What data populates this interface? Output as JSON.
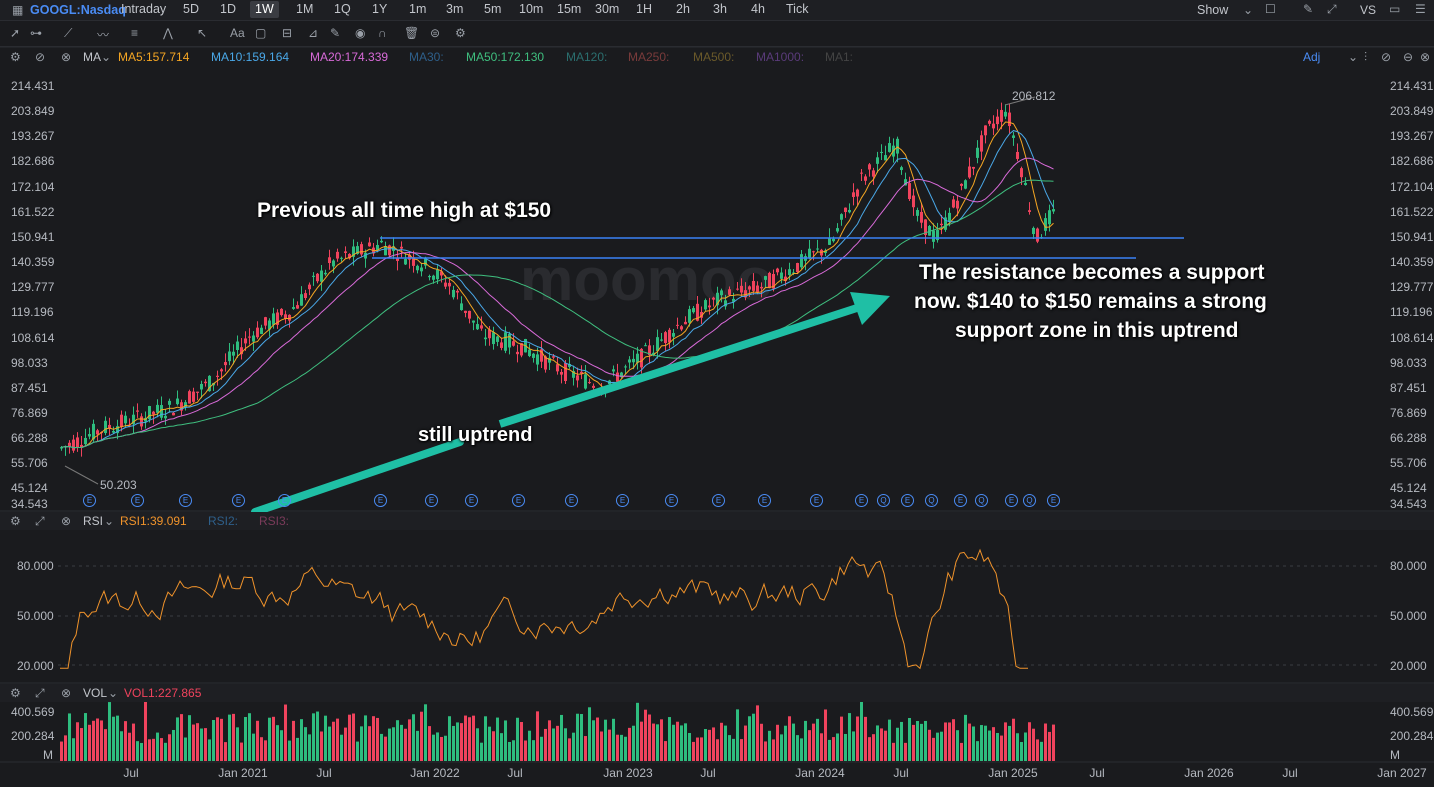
{
  "header": {
    "ticker": "GOOGL:Nasdaq",
    "timeframes": [
      "Intraday",
      "5D",
      "1D",
      "1W",
      "1M",
      "1Q",
      "1Y",
      "1m",
      "3m",
      "5m",
      "10m",
      "15m",
      "30m",
      "1H",
      "2h",
      "3h",
      "4h",
      "Tick"
    ],
    "active_timeframe": "1W",
    "show_label": "Show",
    "vs_label": "VS"
  },
  "ma_bar": {
    "indicator": "MA",
    "items": [
      {
        "label": "MA5:157.714",
        "color": "#f5a623"
      },
      {
        "label": "MA10:159.164",
        "color": "#4aa8e8"
      },
      {
        "label": "MA20:174.339",
        "color": "#d86ad8"
      },
      {
        "label": "MA30:",
        "color": "#2e5f8a"
      },
      {
        "label": "MA50:172.130",
        "color": "#3fbf7f"
      },
      {
        "label": "MA120:",
        "color": "#2b6f6f"
      },
      {
        "label": "MA250:",
        "color": "#7a3b3b"
      },
      {
        "label": "MA500:",
        "color": "#6b5a2a"
      },
      {
        "label": "MA1000:",
        "color": "#5a3b7a"
      },
      {
        "label": "MA1:",
        "color": "#444"
      }
    ],
    "adj_label": "Adj"
  },
  "price_axis": [
    "214.431",
    "203.849",
    "193.267",
    "182.686",
    "172.104",
    "161.522",
    "150.941",
    "140.359",
    "129.777",
    "119.196",
    "108.614",
    "98.033",
    "87.451",
    "76.869",
    "66.288",
    "55.706",
    "45.124",
    "34.543"
  ],
  "price_markers": {
    "high": "206.812",
    "low": "50.203"
  },
  "rsi_bar": {
    "indicator": "RSI",
    "rsi1": "RSI1:39.091",
    "rsi2": "RSI2:",
    "rsi3": "RSI3:"
  },
  "rsi_axis": [
    "80.000",
    "50.000",
    "20.000"
  ],
  "vol_bar": {
    "indicator": "VOL",
    "vol1": "VOL1:227.865"
  },
  "vol_axis": [
    "400.569",
    "200.284",
    "M"
  ],
  "x_axis": [
    "Jul",
    "Jan 2021",
    "Jul",
    "Jan 2022",
    "Jul",
    "Jan 2023",
    "Jul",
    "Jan 2024",
    "Jul",
    "Jan 2025",
    "Jul",
    "Jan 2026",
    "Jul",
    "Jan 2027"
  ],
  "earnings_markers": [
    "E",
    "E",
    "E",
    "E",
    "E",
    "E",
    "E",
    "E",
    "E",
    "E",
    "E",
    "E",
    "E",
    "E",
    "E",
    "E",
    "Q",
    "E",
    "Q",
    "E",
    "Q",
    "E",
    "Q",
    "E"
  ],
  "annotations": {
    "ath": "Previous all time high at $150",
    "uptrend": "still uptrend",
    "support_l1": "The resistance becomes a support",
    "support_l2": "now. $140 to $150 remains a strong",
    "support_l3": "support zone in this uptrend"
  },
  "colors": {
    "up": "#2ebd7f",
    "down": "#f0435d",
    "support_line": "#3b82f6",
    "arrow": "#1fbfa5",
    "rsi": "#f0932b"
  }
}
